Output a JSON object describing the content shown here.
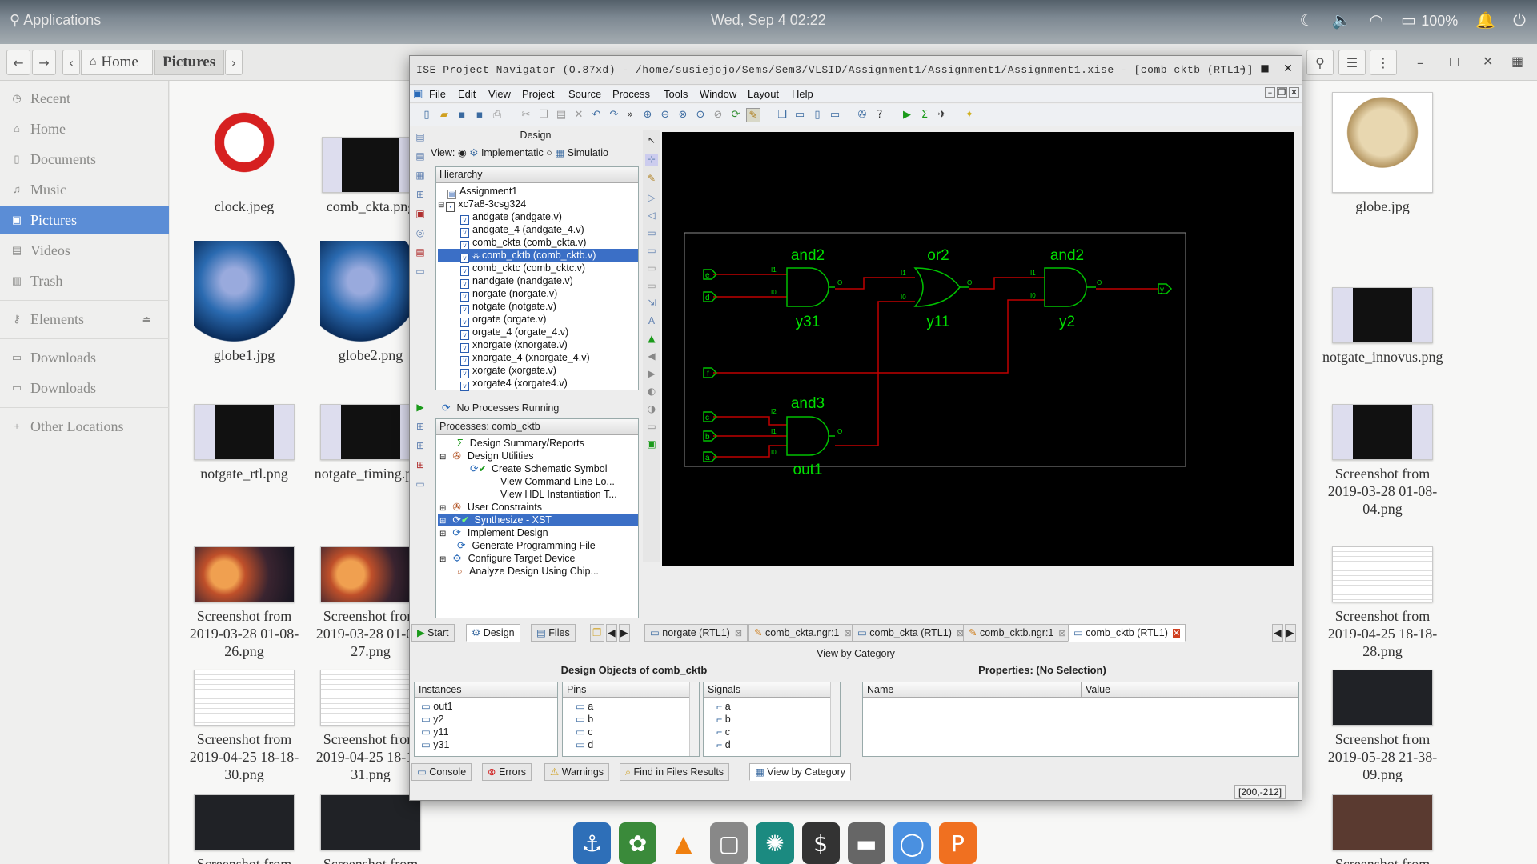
{
  "topbar": {
    "applications": "Applications",
    "datetime": "Wed, Sep  4  02:22",
    "battery": "100%"
  },
  "fm": {
    "path": [
      "Home",
      "Pictures"
    ],
    "sidebar": [
      {
        "label": "Recent",
        "icon": "clock-icon"
      },
      {
        "label": "Home",
        "icon": "home-icon"
      },
      {
        "label": "Documents",
        "icon": "document-icon"
      },
      {
        "label": "Music",
        "icon": "music-icon"
      },
      {
        "label": "Pictures",
        "icon": "pictures-icon"
      },
      {
        "label": "Videos",
        "icon": "video-icon"
      },
      {
        "label": "Trash",
        "icon": "trash-icon"
      },
      {
        "label": "Elements",
        "icon": "usb-drive-icon"
      },
      {
        "label": "Downloads",
        "icon": "folder-icon"
      },
      {
        "label": "Downloads",
        "icon": "folder-icon"
      },
      {
        "label": "Other Locations",
        "icon": "plus-icon"
      }
    ],
    "files": [
      {
        "name": "clock.jpeg"
      },
      {
        "name": "comb_ckta.png"
      },
      {
        "name": "globe1.jpg"
      },
      {
        "name": "globe2.png"
      },
      {
        "name": "notgate_rtl.png"
      },
      {
        "name": "notgate_timing.png"
      },
      {
        "name": "Screenshot from 2019-03-28 01-08-26.png"
      },
      {
        "name": "Screenshot from 2019-03-28 01-08-27.png"
      },
      {
        "name": "Screenshot from 2019-04-25 18-18-30.png"
      },
      {
        "name": "Screenshot from 2019-04-25 18-18-31.png"
      },
      {
        "name": "globe.jpg"
      },
      {
        "name": "notgate_innovus.png"
      },
      {
        "name": "Screenshot from 2019-03-28 01-08-04.png"
      },
      {
        "name": "Screenshot from 2019-04-25 18-18-28.png"
      },
      {
        "name": "Screenshot from 2019-05-28 21-38-09.png"
      },
      {
        "name": "Screenshot from"
      }
    ]
  },
  "ise": {
    "title": "ISE Project Navigator (O.87xd) - /home/susiejojo/Sems/Sem3/VLSID/Assignment1/Assignment1/Assignment1.xise - [comb_cktb (RTL1)]",
    "menu": [
      "File",
      "Edit",
      "View",
      "Project",
      "Source",
      "Process",
      "Tools",
      "Window",
      "Layout",
      "Help"
    ],
    "design_panel": {
      "title": "Design",
      "view_label": "View:",
      "impl": "Implementatic",
      "sim": "Simulatio",
      "hierarchy_hdr": "Hierarchy",
      "hierarchy": [
        "Assignment1",
        "xc7a8-3csg324",
        "andgate (andgate.v)",
        "andgate_4 (andgate_4.v)",
        "comb_ckta (comb_ckta.v)",
        "comb_cktb (comb_cktb.v)",
        "comb_cktc (comb_cktc.v)",
        "nandgate (nandgate.v)",
        "norgate (norgate.v)",
        "notgate (notgate.v)",
        "orgate (orgate.v)",
        "orgate_4 (orgate_4.v)",
        "xnorgate (xnorgate.v)",
        "xnorgate_4 (xnorgate_4.v)",
        "xorgate (xorgate.v)",
        "xorgate4 (xorgate4.v)"
      ],
      "status": "No Processes Running",
      "processes_hdr": "Processes: comb_cktb",
      "processes": [
        "Design Summary/Reports",
        "Design Utilities",
        "Create Schematic Symbol",
        "View Command Line Lo...",
        "View HDL Instantiation T...",
        "User Constraints",
        "Synthesize - XST",
        "Implement Design",
        "Generate Programming File",
        "Configure Target Device",
        "Analyze Design Using Chip..."
      ],
      "bottom_tabs": [
        "Start",
        "Design",
        "Files"
      ]
    },
    "schematic": {
      "gates": [
        {
          "type": "and2",
          "inst": "y31",
          "in0": "I0",
          "in1": "I1",
          "out": "O"
        },
        {
          "type": "or2",
          "inst": "y11",
          "in0": "I0",
          "in1": "I1",
          "out": "O"
        },
        {
          "type": "and2",
          "inst": "y2",
          "in0": "I0",
          "in1": "I1",
          "out": "O"
        },
        {
          "type": "and3",
          "inst": "out1",
          "in0": "I0",
          "in1": "I1",
          "in2": "I2",
          "out": "O"
        }
      ],
      "ports": [
        "e",
        "d",
        "f",
        "c",
        "b",
        "a",
        "y"
      ]
    },
    "doc_tabs": [
      {
        "label": "norgate (RTL1)"
      },
      {
        "label": "comb_ckta.ngr:1"
      },
      {
        "label": "comb_ckta (RTL1)"
      },
      {
        "label": "comb_cktb.ngr:1"
      },
      {
        "label": "comb_cktb (RTL1)"
      }
    ],
    "bottom": {
      "title": "View by Category",
      "objects_title": "Design Objects of comb_cktb",
      "props_title": "Properties: (No Selection)",
      "instances_hdr": "Instances",
      "instances": [
        "out1",
        "y2",
        "y11",
        "y31"
      ],
      "pins_hdr": "Pins",
      "pins": [
        "a",
        "b",
        "c",
        "d"
      ],
      "signals_hdr": "Signals",
      "signals": [
        "a",
        "b",
        "c",
        "d"
      ],
      "name_hdr": "Name",
      "value_hdr": "Value",
      "console_tabs": [
        "Console",
        "Errors",
        "Warnings",
        "Find in Files Results",
        "View by Category"
      ],
      "coords": "[200,-212]"
    }
  }
}
